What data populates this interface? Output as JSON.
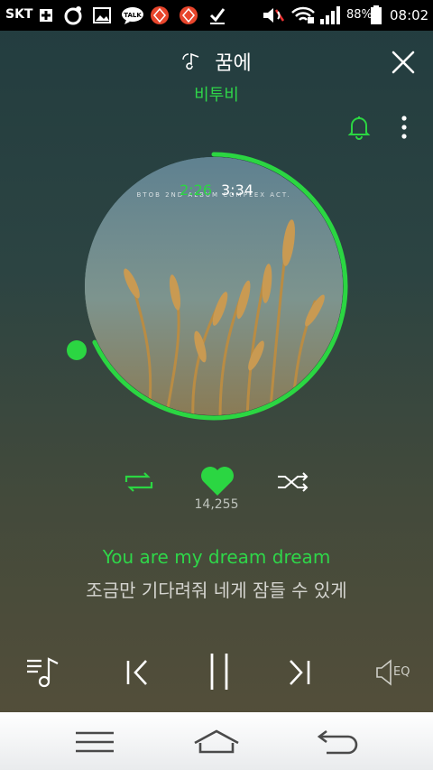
{
  "status_bar": {
    "carrier": "SKT",
    "battery_percent": "88%",
    "time": "08:02",
    "icons": [
      "usb-icon",
      "settings-icon",
      "gallery-icon",
      "talk-icon",
      "app-icon",
      "app-icon",
      "download-icon",
      "mute-icon",
      "wifi-icon",
      "signal-icon",
      "battery-icon"
    ],
    "talk_label": "TALK"
  },
  "player": {
    "song_title": "꿈에",
    "artist": "비투비",
    "album_caption": "BTOB 2ND ALBUM  COMPLEX ACT.",
    "time_elapsed": "2:26",
    "time_total": "3:34",
    "progress": 0.68,
    "like_count": "14,255",
    "lyric_current": "You are my dream dream",
    "lyric_next": "조금만 기다려줘 네게 잠들 수 있게",
    "eq_label": "EQ"
  },
  "colors": {
    "accent": "#2bd642",
    "background_top": "#223c3f",
    "background_bottom": "#574f39"
  }
}
